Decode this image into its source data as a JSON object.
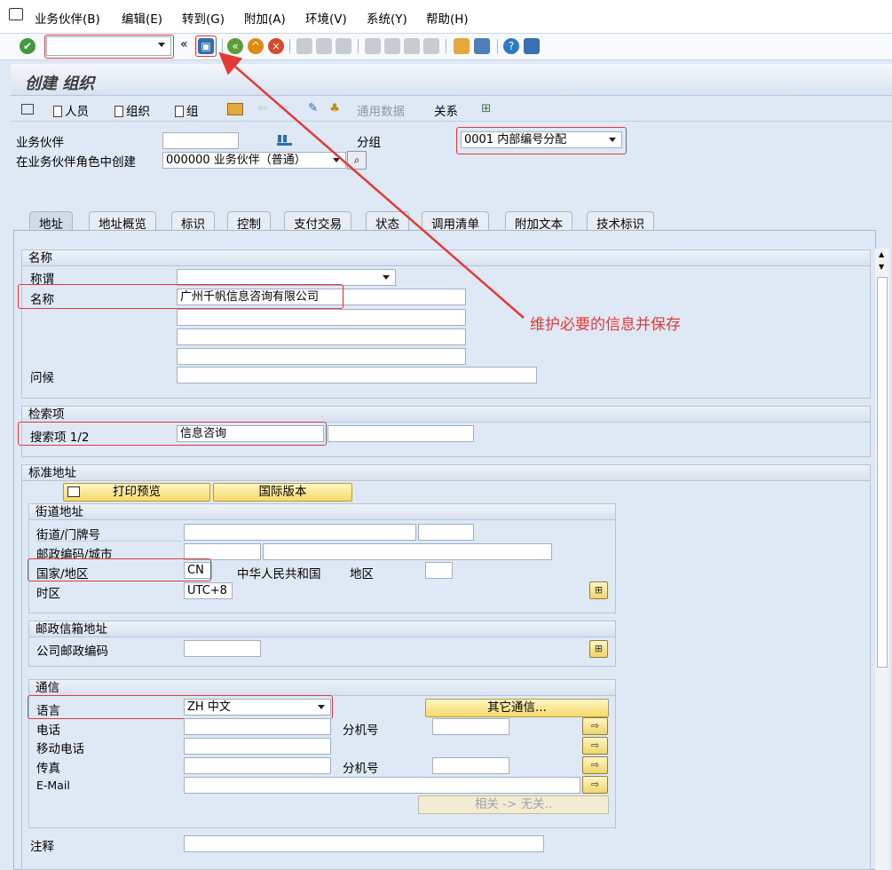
{
  "menu": [
    "业务伙伴(B)",
    "编辑(E)",
    "转到(G)",
    "附加(A)",
    "环境(V)",
    "系统(Y)",
    "帮助(H)"
  ],
  "toolbar": {
    "command_field": "",
    "chevron": "«"
  },
  "title": "创建 组织",
  "app_toolbar": {
    "person": "人员",
    "org": "组织",
    "group": "组",
    "general_data": "通用数据",
    "relations": "关系"
  },
  "header": {
    "bp_label": "业务伙伴",
    "bp_value": "",
    "grouping_label": "分组",
    "grouping_value": "0001 内部编号分配",
    "role_label": "在业务伙伴角色中创建",
    "role_value": "000000 业务伙伴（普通）"
  },
  "tabs": [
    "地址",
    "地址概览",
    "标识",
    "控制",
    "支付交易",
    "状态",
    "调用清单",
    "附加文本",
    "技术标识"
  ],
  "name_section": {
    "header": "名称",
    "title_label": "称谓",
    "title_value": "",
    "name_label": "名称",
    "name_value": "广州千帆信息咨询有限公司",
    "greeting_label": "问候"
  },
  "search_section": {
    "header": "检索项",
    "term_label": "搜索项 1/2",
    "term1": "信息咨询",
    "term2": ""
  },
  "std_address": {
    "header": "标准地址",
    "print_preview": "打印预览",
    "intl_version": "国际版本"
  },
  "street_address": {
    "header": "街道地址",
    "street_label": "街道/门牌号",
    "postal_label": "邮政编码/城市",
    "country_label": "国家/地区",
    "country_code": "CN",
    "country_name": "中华人民共和国",
    "region_label": "地区",
    "timezone_label": "时区",
    "timezone_value": "UTC+8"
  },
  "po_box": {
    "header": "邮政信箱地址",
    "company_postal_label": "公司邮政编码"
  },
  "communication": {
    "header": "通信",
    "language_label": "语言",
    "language_value": "ZH 中文",
    "other_comm": "其它通信...",
    "phone_label": "电话",
    "ext_label": "分机号",
    "mobile_label": "移动电话",
    "fax_label": "传真",
    "fax_ext_label": "分机号",
    "email_label": "E-Mail",
    "related_btn": "相关 -> 无关.."
  },
  "notes_label": "注释",
  "annotation": {
    "text": "维护必要的信息并保存",
    "color": "#e53935"
  }
}
